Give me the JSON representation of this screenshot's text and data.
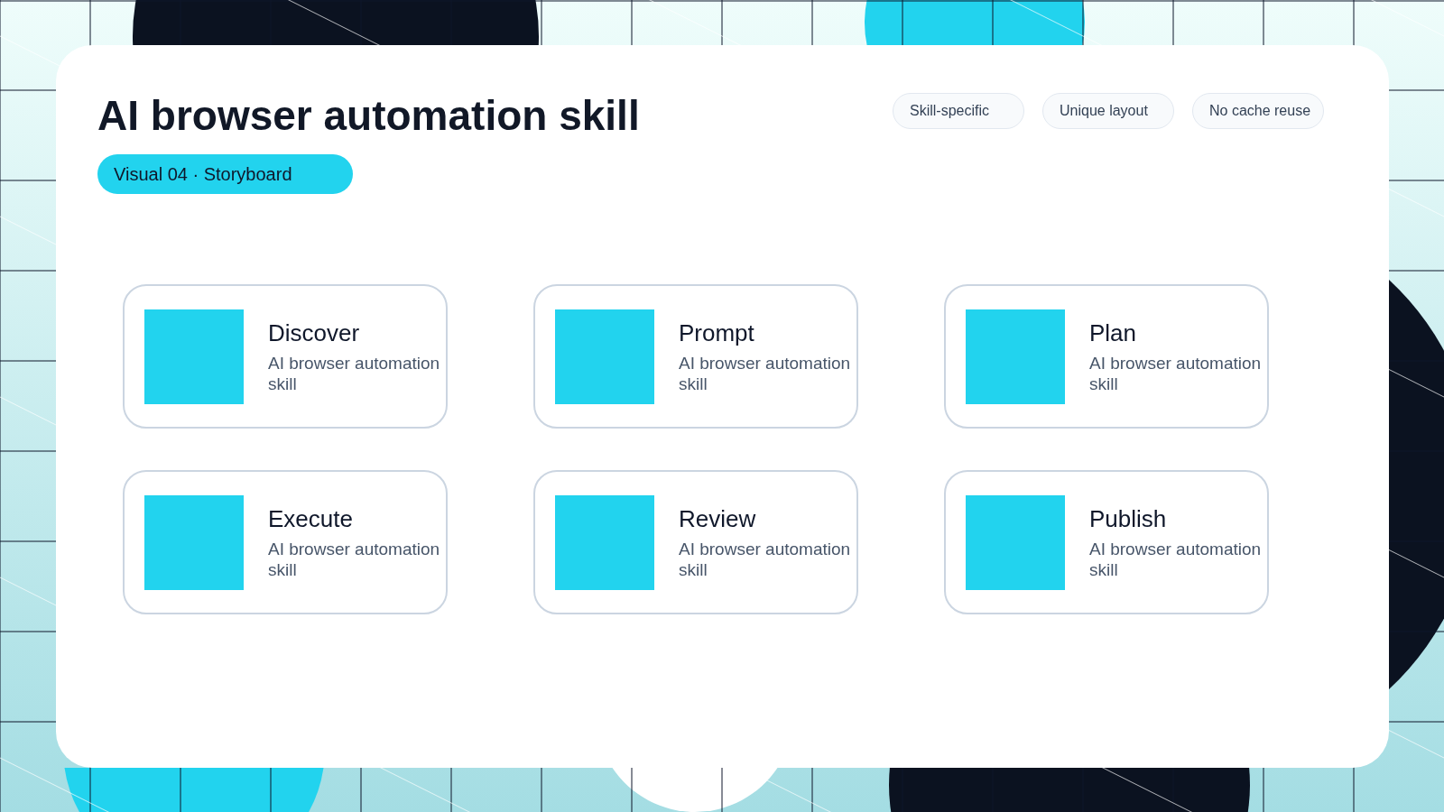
{
  "title": "AI browser automation skill",
  "subtitle_pill": "Visual 04 · Storyboard",
  "tags": [
    "Skill-specific",
    "Unique layout",
    "No cache reuse"
  ],
  "steps": [
    {
      "title": "Discover",
      "description": "AI browser automation skill"
    },
    {
      "title": "Prompt",
      "description": "AI browser automation skill"
    },
    {
      "title": "Plan",
      "description": "AI browser automation skill"
    },
    {
      "title": "Execute",
      "description": "AI browser automation skill"
    },
    {
      "title": "Review",
      "description": "AI browser automation skill"
    },
    {
      "title": "Publish",
      "description": "AI browser automation skill"
    }
  ]
}
